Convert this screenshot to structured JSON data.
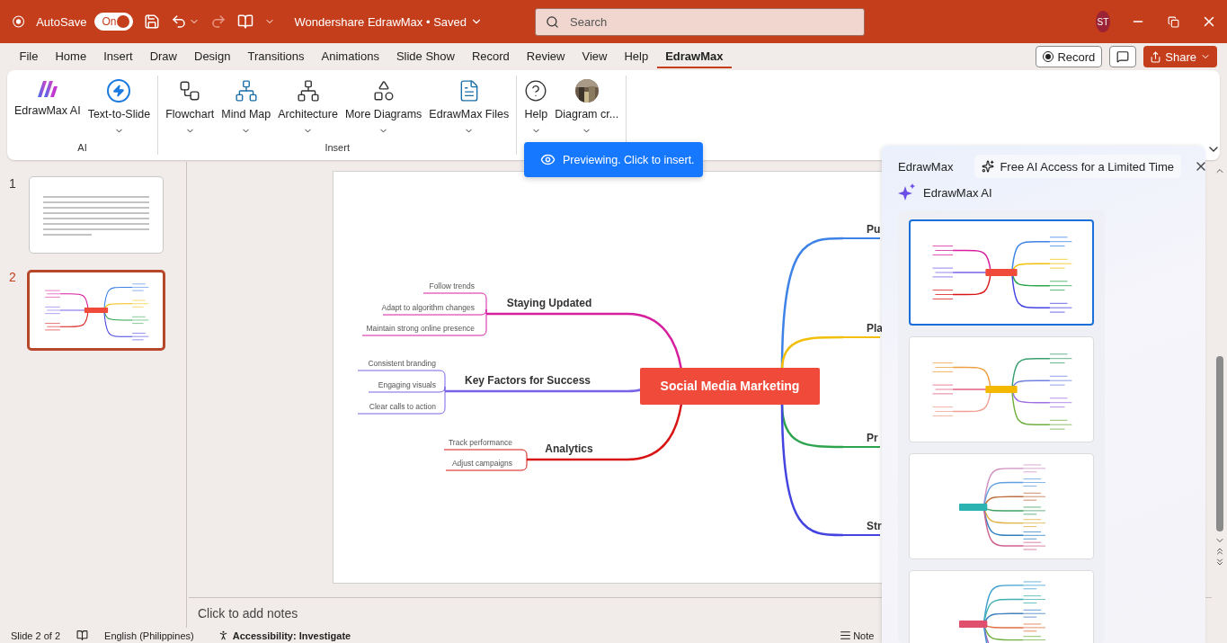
{
  "title_bar": {
    "autosave_label": "AutoSave",
    "autosave": {
      "label": "On",
      "on": true
    },
    "document_title": "Wondershare EdrawMax • Saved",
    "search": {
      "placeholder": "Search"
    },
    "user_initials": "ST"
  },
  "menu_tabs": [
    {
      "label": "File",
      "selected": false
    },
    {
      "label": "Home",
      "selected": false
    },
    {
      "label": "Insert",
      "selected": false
    },
    {
      "label": "Draw",
      "selected": false
    },
    {
      "label": "Design",
      "selected": false
    },
    {
      "label": "Transitions",
      "selected": false
    },
    {
      "label": "Animations",
      "selected": false
    },
    {
      "label": "Slide Show",
      "selected": false
    },
    {
      "label": "Record",
      "selected": false
    },
    {
      "label": "Review",
      "selected": false
    },
    {
      "label": "View",
      "selected": false
    },
    {
      "label": "Help",
      "selected": false
    },
    {
      "label": "EdrawMax",
      "selected": true
    }
  ],
  "header_actions": {
    "record": "Record",
    "share": "Share"
  },
  "ribbon": {
    "groups": [
      {
        "label": "AI",
        "buttons": [
          {
            "label": "EdrawMax AI",
            "kind": "ai",
            "dropdown": false
          },
          {
            "label": "Text-to-Slide",
            "kind": "bolt",
            "dropdown": true
          }
        ]
      },
      {
        "label": "Insert",
        "buttons": [
          {
            "label": "Flowchart",
            "kind": "flowchart",
            "dropdown": true
          },
          {
            "label": "Mind Map",
            "kind": "mindmap",
            "dropdown": true
          },
          {
            "label": "Architecture",
            "kind": "architecture",
            "dropdown": true
          },
          {
            "label": "More Diagrams",
            "kind": "shapes",
            "dropdown": true
          },
          {
            "label": "EdrawMax Files",
            "kind": "file",
            "dropdown": true
          }
        ]
      },
      {
        "buttons": [
          {
            "label": "Help",
            "kind": "help",
            "dropdown": true
          },
          {
            "label": "Diagram cr...",
            "dropdown": true
          }
        ]
      }
    ]
  },
  "slides": [
    {
      "number": "1",
      "kind": "text",
      "selected": false
    },
    {
      "number": "2",
      "kind": "mindmap",
      "selected": true
    }
  ],
  "mindmap": {
    "central": "Social Media Marketing",
    "left": [
      {
        "label": "Staying Updated",
        "color": "#d61f9f",
        "children": [
          "Follow trends",
          "Adapt to algorithm changes",
          "Maintain strong online presence"
        ]
      },
      {
        "label": "Key Factors for Success",
        "color": "#7a62e8",
        "children": [
          "Consistent branding",
          "Engaging visuals",
          "Clear calls to action"
        ]
      },
      {
        "label": "Analytics",
        "color": "#d81414",
        "children": [
          "Track performance",
          "Adjust campaigns"
        ]
      }
    ],
    "right": [
      {
        "label": "Pu",
        "color": "#3d82e6"
      },
      {
        "label": "Pla",
        "color": "#f2bf0a"
      },
      {
        "label": "Pr",
        "color": "#2ea44f"
      },
      {
        "label": "Str",
        "color": "#4444e0"
      }
    ]
  },
  "notes_placeholder": "Click to add notes",
  "preview_toast": "Previewing. Click to insert.",
  "edrawmax_panel": {
    "brand": "EdrawMax",
    "promo": "Free AI Access for a Limited Time",
    "section": "EdrawMax AI",
    "templates": [
      {
        "kind": "horizontal",
        "color": "#f04a3a",
        "selected": true
      },
      {
        "kind": "horizontal",
        "color": "#f5b800",
        "selected": false
      },
      {
        "kind": "vertical",
        "color": "#2bb3b1",
        "selected": false
      },
      {
        "kind": "vertical",
        "color": "#e0506e",
        "selected": false
      }
    ]
  },
  "status_bar": {
    "slide_info": "Slide 2 of 2",
    "language": "English (Philippines)",
    "accessibility": "Accessibility: Investigate",
    "notes": "Note"
  }
}
